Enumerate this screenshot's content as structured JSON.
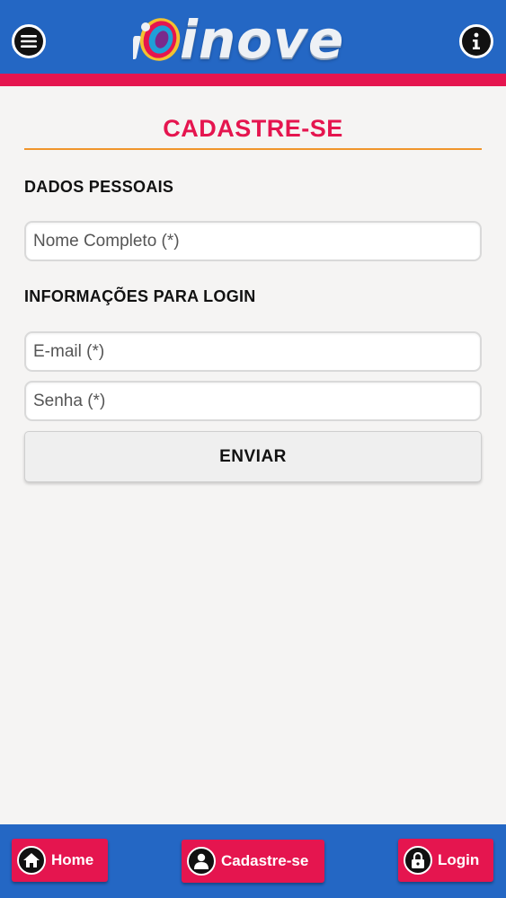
{
  "header": {
    "logo_text": "inove",
    "menu_icon": "hamburger-menu-icon",
    "info_icon": "info-icon",
    "brand_color": "#2467c4",
    "accent_color": "#e5154f"
  },
  "page": {
    "title": "CADASTRE-SE",
    "section_personal": "DADOS PESSOAIS",
    "section_login": "INFORMAÇÕES PARA LOGIN"
  },
  "form": {
    "name_placeholder": "Nome Completo (*)",
    "email_placeholder": "E-mail (*)",
    "password_placeholder": "Senha (*)",
    "submit_label": "ENVIAR"
  },
  "footer": {
    "home_label": "Home",
    "home_icon": "home-icon",
    "register_label": "Cadastre-se",
    "register_icon": "user-icon",
    "login_label": "Login",
    "login_icon": "lock-icon"
  }
}
